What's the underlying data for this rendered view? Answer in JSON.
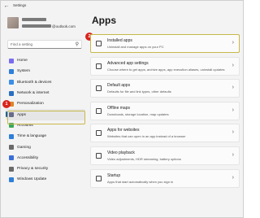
{
  "window": {
    "title": "Settings",
    "back_icon": "back-arrow-icon"
  },
  "profile": {
    "email_suffix": "@outlook.com"
  },
  "search": {
    "placeholder": "Find a setting",
    "icon": "search-icon"
  },
  "sidebar": {
    "items": [
      {
        "label": "Home",
        "color": "#7a6cf0"
      },
      {
        "label": "System",
        "color": "#2d7fd9"
      },
      {
        "label": "Bluetooth & devices",
        "color": "#3a8ee6"
      },
      {
        "label": "Network & internet",
        "color": "#2a6fc0"
      },
      {
        "label": "Personalization",
        "color": "#d9882a"
      },
      {
        "label": "Apps",
        "color": "#6a6a8a",
        "selected": true
      },
      {
        "label": "Accounts",
        "color": "#3aa85a"
      },
      {
        "label": "Time & language",
        "color": "#2d7fd9"
      },
      {
        "label": "Gaming",
        "color": "#6a6a6a"
      },
      {
        "label": "Accessibility",
        "color": "#3a6fd9"
      },
      {
        "label": "Privacy & security",
        "color": "#6a6a6a"
      },
      {
        "label": "Windows Update",
        "color": "#2d7fd9"
      }
    ]
  },
  "badges": {
    "apps_nav": "1",
    "installed_apps": "2",
    "color": "#d9231d"
  },
  "main": {
    "title": "Apps",
    "cards": [
      {
        "title": "Installed apps",
        "desc": "Uninstall and manage apps on your PC"
      },
      {
        "title": "Advanced app settings",
        "desc": "Choose where to get apps, archive apps, app execution aliases, uninstall updates"
      },
      {
        "title": "Default apps",
        "desc": "Defaults for file and link types, other defaults"
      },
      {
        "title": "Offline maps",
        "desc": "Downloads, storage location, map updates"
      },
      {
        "title": "Apps for websites",
        "desc": "Websites that can open in an app instead of a browser"
      },
      {
        "title": "Video playback",
        "desc": "Video adjustments, HDR streaming, battery options"
      },
      {
        "title": "Startup",
        "desc": "Apps that start automatically when you sign in"
      }
    ]
  }
}
